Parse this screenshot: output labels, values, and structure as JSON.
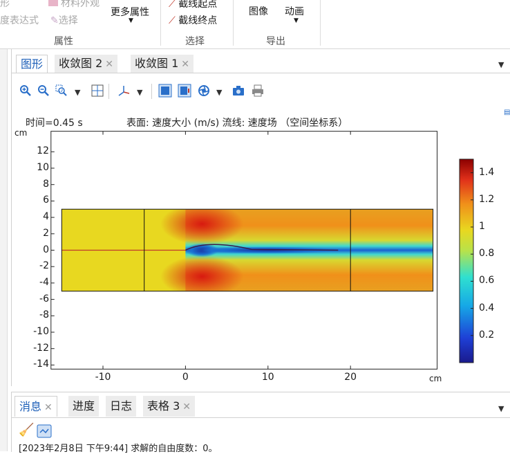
{
  "ribbon": {
    "partial_items": [
      "形",
      "材料外观",
      "度表达式",
      "选择"
    ],
    "more_properties": "更多属性",
    "cut_line_start": "截线起点",
    "cut_line_end": "截线终点",
    "image_btn": "图像",
    "animation_btn": "动画",
    "groups": {
      "properties": "属性",
      "selection": "选择",
      "export": "导出"
    }
  },
  "graphics": {
    "tabs": [
      {
        "label": "图形",
        "active": true
      },
      {
        "label": "收敛图 2",
        "active": false
      },
      {
        "label": "收敛图 1",
        "active": false
      }
    ],
    "toolbar_icons": [
      "zoom-in-icon",
      "zoom-out-icon",
      "zoom-box-icon",
      "zoom-extents-icon",
      "axes-view-icon",
      "scene-light-icon",
      "transparency-icon",
      "wireframe-icon",
      "camera-icon",
      "print-icon"
    ],
    "caption_time": "时间=0.45 s",
    "caption_desc": "表面: 速度大小 (m/s)  流线: 速度场  （空间坐标系）"
  },
  "plot": {
    "unit_label": "cm",
    "y_ticks": [
      "12",
      "10",
      "8",
      "6",
      "4",
      "2",
      "0",
      "-2",
      "-4",
      "-6",
      "-8",
      "-10",
      "-12",
      "-14"
    ],
    "x_ticks": [
      "-10",
      "0",
      "10",
      "20"
    ],
    "x_unit": "cm",
    "colorbar_ticks": [
      "1.4",
      "1.2",
      "1",
      "0.8",
      "0.6",
      "0.4",
      "0.2"
    ],
    "colors": {
      "high": "#8b0000",
      "mid": "#e8d820",
      "low": "#1a1a8c",
      "stream": "#c0392b"
    }
  },
  "chart_data": {
    "type": "heatmap",
    "field": "速度大小 (m/s)",
    "time": "0.45 s",
    "x_range_cm": [
      -15,
      30
    ],
    "y_range_cm": [
      -14,
      13
    ],
    "domain_cm": {
      "x": [
        -15,
        30
      ],
      "y": [
        -5,
        5
      ]
    },
    "subdomain_lines_x_cm": [
      -5,
      20
    ],
    "color_range": [
      0,
      1.5
    ],
    "colorbar_ticks": [
      1.4,
      1.2,
      1.0,
      0.8,
      0.6,
      0.4,
      0.2
    ]
  },
  "messages": {
    "tabs": [
      {
        "label": "消息",
        "active": true
      },
      {
        "label": "进度",
        "active": false
      },
      {
        "label": "日志",
        "active": false
      },
      {
        "label": "表格 3",
        "active": false
      }
    ],
    "log_line": "[2023年2月8日 下午9:44] 求解的自由度数：0。"
  }
}
